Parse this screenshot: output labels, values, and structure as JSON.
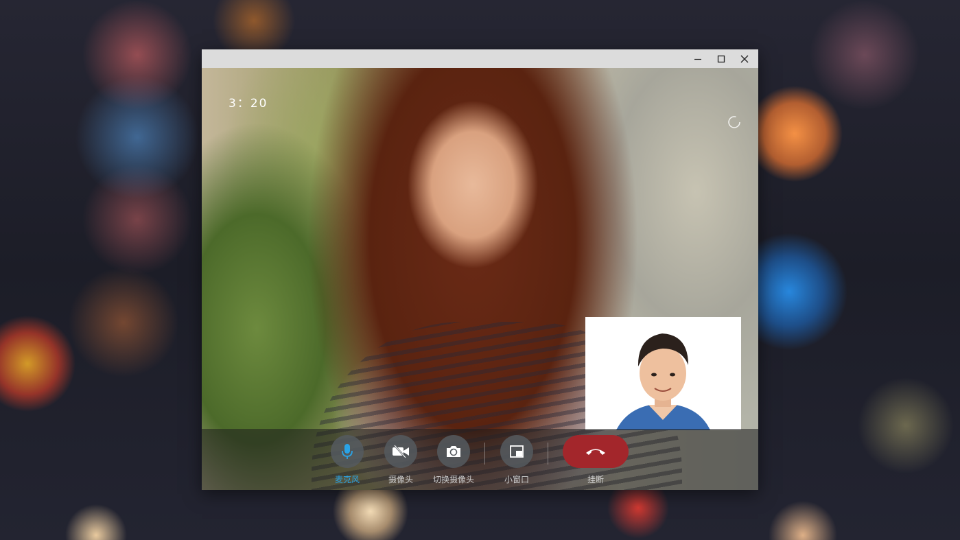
{
  "window": {
    "controls": {
      "minimize_icon": "minimize-icon",
      "maximize_icon": "maximize-icon",
      "close_icon": "close-icon"
    }
  },
  "call": {
    "timer": "3：20",
    "loading_icon": "loading-spinner-icon"
  },
  "controls": {
    "mic_label": "麦克风",
    "camera_label": "摄像头",
    "switch_camera_label": "切换摄像头",
    "mini_window_label": "小窗口",
    "hangup_label": "挂断"
  },
  "colors": {
    "accent": "#2aa3e6",
    "hangup": "#a3262b",
    "titlebar": "#dcdcdc"
  }
}
